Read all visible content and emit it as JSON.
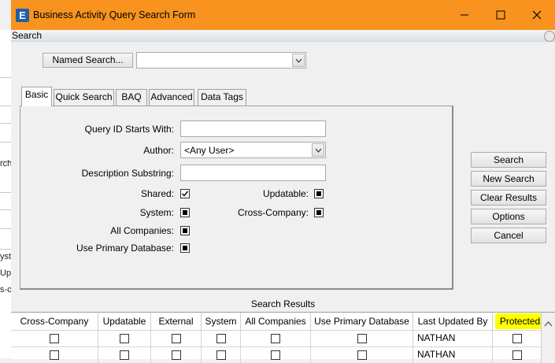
{
  "window": {
    "title": "Business Activity Query Search Form",
    "app_icon_letter": "E"
  },
  "menu": {
    "search": "Search"
  },
  "background_app": {
    "fragments": [
      "rch",
      "yst",
      "Up",
      "s-c"
    ]
  },
  "named_search": {
    "button": "Named Search...",
    "value": ""
  },
  "tabs": [
    {
      "label": "Basic",
      "active": true
    },
    {
      "label": "Quick Search",
      "active": false
    },
    {
      "label": "BAQ",
      "active": false
    },
    {
      "label": "Advanced",
      "active": false
    },
    {
      "label": "Data Tags",
      "active": false
    }
  ],
  "form": {
    "query_id_label": "Query ID Starts With:",
    "query_id_value": "",
    "author_label": "Author:",
    "author_value": "<Any User>",
    "description_label": "Description Substring:",
    "description_value": "",
    "shared_label": "Shared:",
    "shared_state": "checked",
    "updatable_label": "Updatable:",
    "updatable_state": "indeterminate",
    "system_label": "System:",
    "system_state": "indeterminate",
    "cross_company_label": "Cross-Company:",
    "cross_company_state": "indeterminate",
    "all_companies_label": "All Companies:",
    "all_companies_state": "indeterminate",
    "use_primary_label": "Use Primary Database:",
    "use_primary_state": "indeterminate"
  },
  "actions": {
    "search": "Search",
    "new_search": "New Search",
    "clear_results": "Clear Results",
    "options": "Options",
    "cancel": "Cancel"
  },
  "results": {
    "title": "Search Results",
    "columns": [
      "Cross-Company",
      "Updatable",
      "External",
      "System",
      "All Companies",
      "Use Primary Database",
      "Last Updated By",
      "Protected"
    ],
    "highlighted_column": "Protected",
    "highlight_color": "#ffff00",
    "rows": [
      {
        "last_updated_by": "NATHAN"
      },
      {
        "last_updated_by": "NATHAN"
      }
    ]
  },
  "colors": {
    "titlebar": "#f7931e",
    "app_icon": "#1f5fa8"
  }
}
